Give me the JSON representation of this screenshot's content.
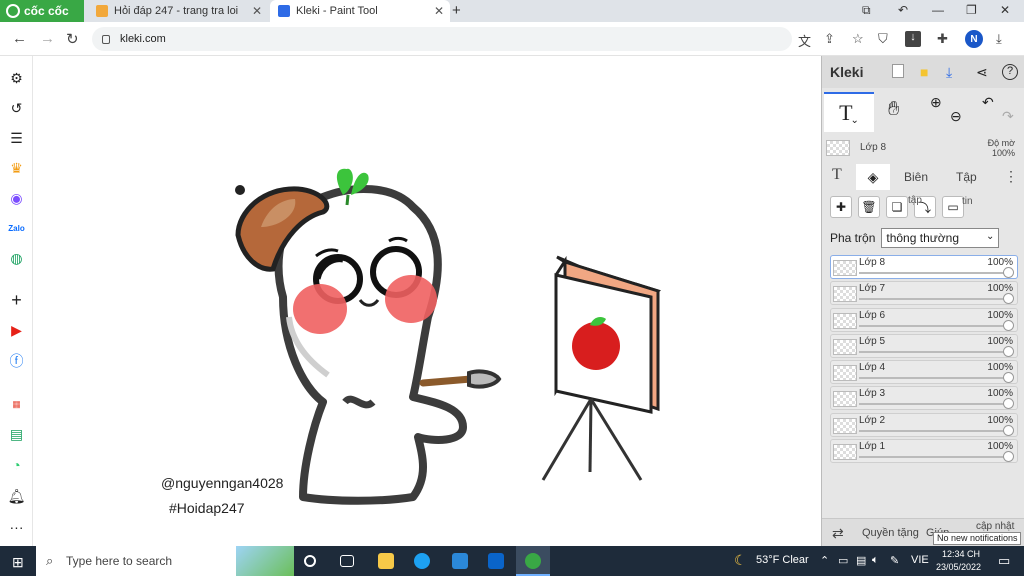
{
  "browser": {
    "brand": "cốc cốc",
    "tabs": [
      {
        "title": "Hỏi đáp 247 - trang tra loi",
        "active": false
      },
      {
        "title": "Kleki - Paint Tool",
        "active": true
      }
    ],
    "url": "kleki.com",
    "profile_initial": "N"
  },
  "canvas": {
    "credit_handle": "@nguyenngan4028",
    "credit_tag": "#Hoidap247"
  },
  "kleki": {
    "app_name": "Kleki",
    "current_layer": {
      "name": "Lớp 8",
      "opacity_label": "Độ mờ",
      "opacity": "100%"
    },
    "panel_tabs": [
      "T",
      "layers",
      "Biên",
      "Tập"
    ],
    "action_labels": {
      "merge": "tập",
      "info": "tin"
    },
    "blend_label": "Pha trộn",
    "blend_mode": "thông thường",
    "layers": [
      {
        "name": "Lớp 8",
        "opacity": "100%",
        "selected": true
      },
      {
        "name": "Lớp 7",
        "opacity": "100%",
        "selected": false
      },
      {
        "name": "Lớp 6",
        "opacity": "100%",
        "selected": false
      },
      {
        "name": "Lớp 5",
        "opacity": "100%",
        "selected": false
      },
      {
        "name": "Lớp 4",
        "opacity": "100%",
        "selected": false
      },
      {
        "name": "Lớp 3",
        "opacity": "100%",
        "selected": false
      },
      {
        "name": "Lớp 2",
        "opacity": "100%",
        "selected": false
      },
      {
        "name": "Lớp 1",
        "opacity": "100%",
        "selected": false
      }
    ],
    "bottom": {
      "rotate": "Quyền tặng",
      "help": "Giúp",
      "update": "cập nhật"
    }
  },
  "taskbar": {
    "search_placeholder": "Type here to search",
    "weather": "53°F  Clear",
    "language": "VIE",
    "time": "12:34 CH",
    "date": "23/05/2022",
    "notification": "No new notifications"
  },
  "colors": {
    "accent": "#2e6be6",
    "brand": "#39a845",
    "taskbar": "#1e2b3a"
  }
}
